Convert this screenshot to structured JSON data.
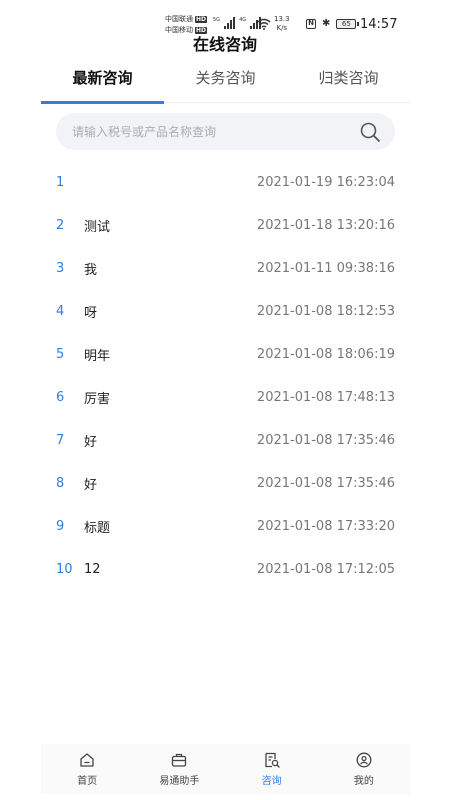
{
  "status": {
    "carrier1": "中国联通",
    "carrier2": "中国移动",
    "hd_badge": "HD",
    "net_label1": "5G",
    "net_label2": "4G",
    "speed_value": "13.3",
    "speed_unit": "K/s",
    "battery": "65",
    "time": "14:57"
  },
  "page_title": "在线咨询",
  "tabs": [
    {
      "label": "最新咨询",
      "active": true
    },
    {
      "label": "关务咨询",
      "active": false
    },
    {
      "label": "归类咨询",
      "active": false
    }
  ],
  "search": {
    "placeholder": "请输入税号或产品名称查询",
    "value": ""
  },
  "list": [
    {
      "index": "1",
      "title": "",
      "time": "2021-01-19 16:23:04"
    },
    {
      "index": "2",
      "title": "测试",
      "time": "2021-01-18 13:20:16"
    },
    {
      "index": "3",
      "title": "我",
      "time": "2021-01-11 09:38:16"
    },
    {
      "index": "4",
      "title": "呀",
      "time": "2021-01-08 18:12:53"
    },
    {
      "index": "5",
      "title": "明年",
      "time": "2021-01-08 18:06:19"
    },
    {
      "index": "6",
      "title": "厉害",
      "time": "2021-01-08 17:48:13"
    },
    {
      "index": "7",
      "title": "好",
      "time": "2021-01-08 17:35:46"
    },
    {
      "index": "8",
      "title": "好",
      "time": "2021-01-08 17:35:46"
    },
    {
      "index": "9",
      "title": "标题",
      "time": "2021-01-08 17:33:20"
    },
    {
      "index": "10",
      "title": "12",
      "time": "2021-01-08 17:12:05"
    }
  ],
  "bottom_nav": [
    {
      "label": "首页",
      "icon": "home-icon",
      "active": false
    },
    {
      "label": "易通助手",
      "icon": "briefcase-icon",
      "active": false
    },
    {
      "label": "咨询",
      "icon": "consult-icon",
      "active": true
    },
    {
      "label": "我的",
      "icon": "profile-icon",
      "active": false
    }
  ],
  "colors": {
    "accent": "#2f7ee0",
    "inactive": "#555555"
  }
}
